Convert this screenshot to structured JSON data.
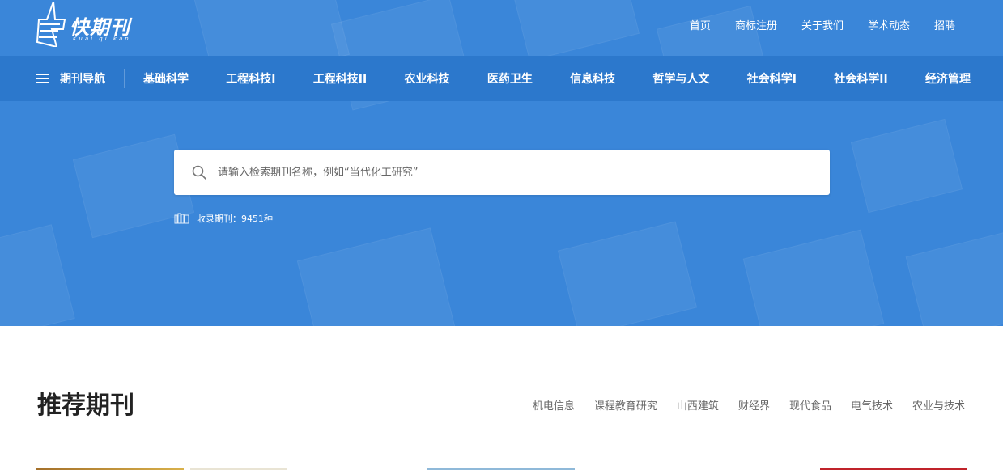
{
  "brand": {
    "name": "快期刊",
    "pinyin": "Kuai qi kan"
  },
  "top_links": [
    "首页",
    "商标注册",
    "关于我们",
    "学术动态",
    "招聘"
  ],
  "nav": {
    "menu_label": "期刊导航",
    "items": [
      "基础科学",
      "工程科技I",
      "工程科技II",
      "农业科技",
      "医药卫生",
      "信息科技",
      "哲学与人文",
      "社会科学I",
      "社会科学II",
      "经济管理"
    ]
  },
  "search": {
    "placeholder": "请输入检索期刊名称，例如“当代化工研究”"
  },
  "collection": {
    "label": "收录期刊：9451种"
  },
  "recommended": {
    "title": "推荐期刊",
    "tags": [
      "机电信息",
      "课程教育研究",
      "山西建筑",
      "财经界",
      "现代食品",
      "电气技术",
      "农业与技术"
    ]
  },
  "colors": {
    "hero_bg": "#3a86d9",
    "nav_bg": "#2c78cc",
    "title_text": "#222222",
    "tag_text": "#666666"
  }
}
